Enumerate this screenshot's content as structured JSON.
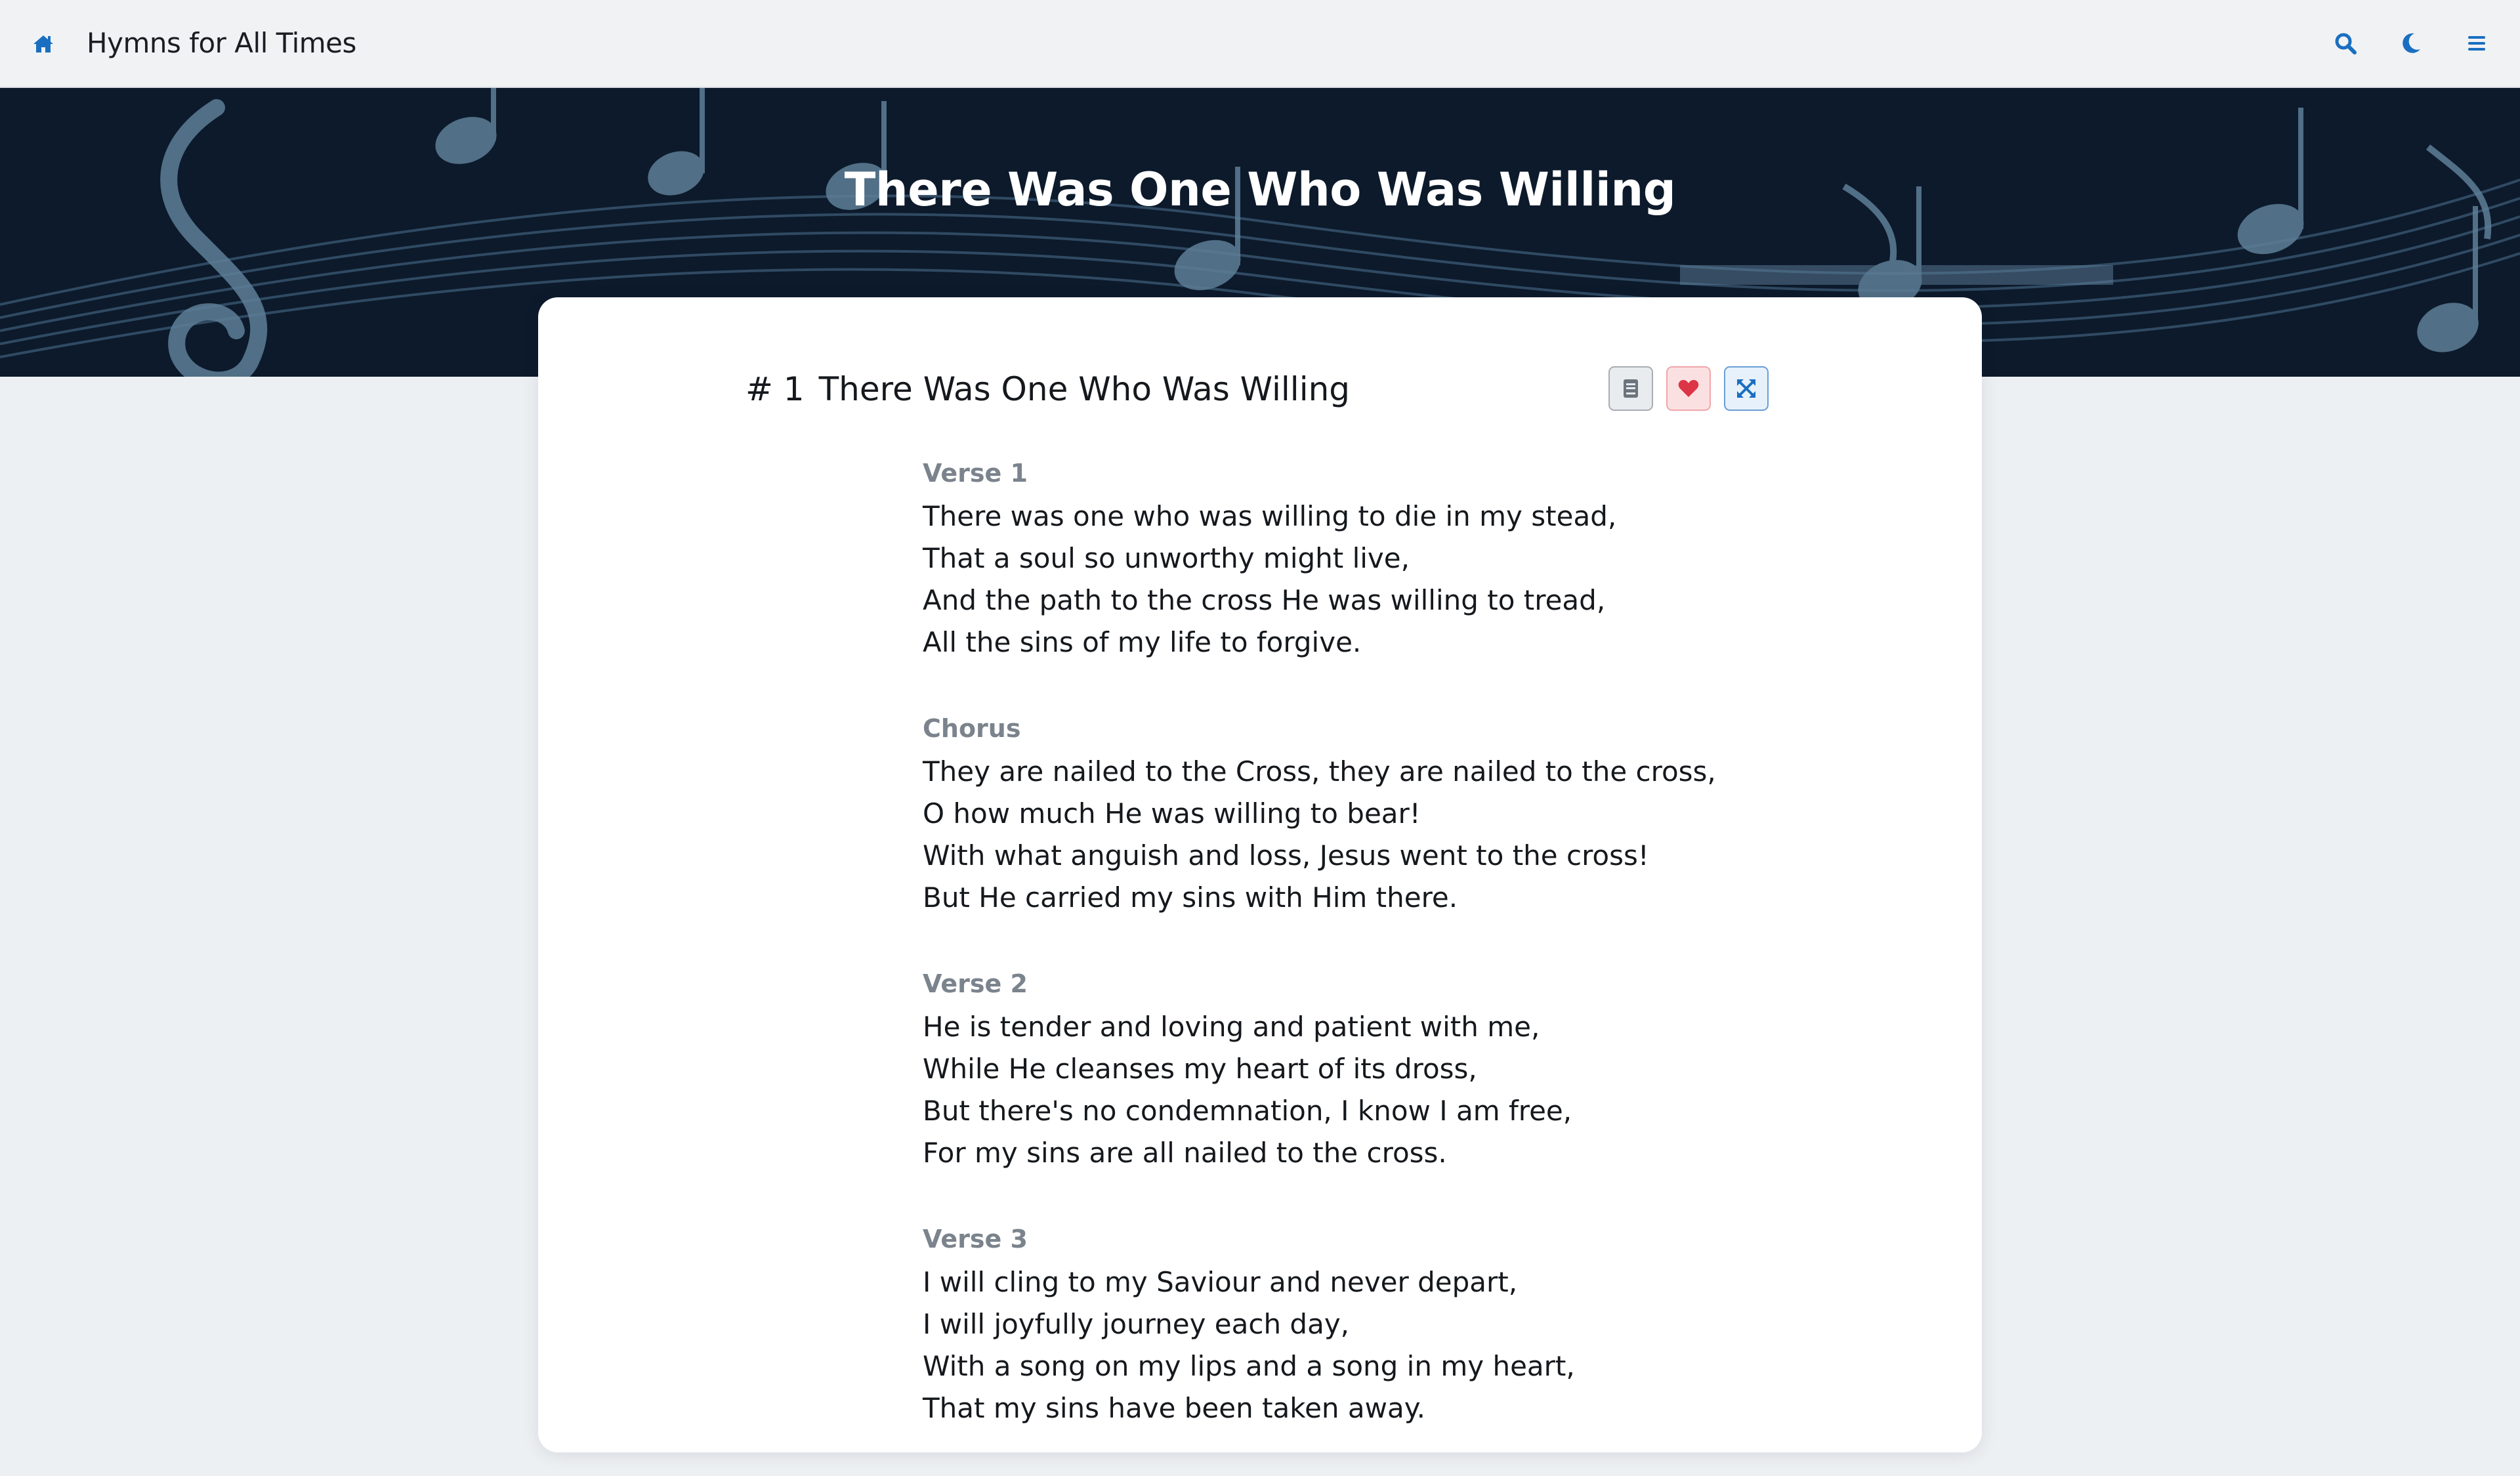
{
  "navbar": {
    "brand": "Hymns for All Times",
    "home_icon": "home-icon",
    "search_icon": "search-icon",
    "theme_icon": "moon-icon",
    "menu_icon": "menu-icon"
  },
  "hero": {
    "title": "There Was One Who Was Willing"
  },
  "hymn": {
    "number": "# 1",
    "title": "There Was One Who Was Willing",
    "actions": {
      "print_icon": "book-icon",
      "favorite_icon": "heart-icon",
      "fullscreen_icon": "expand-icon"
    },
    "stanzas": [
      {
        "label": "Verse 1",
        "lines": [
          "There was one who was willing to die in my stead,",
          "That a soul so unworthy might live,",
          "And the path to the cross He was willing to tread,",
          "All the sins of my life to forgive."
        ]
      },
      {
        "label": "Chorus",
        "lines": [
          "They are nailed to the Cross, they are nailed to the cross,",
          "O how much He was willing to bear!",
          "With what anguish and loss, Jesus went to the cross!",
          "But He carried my sins with Him there."
        ]
      },
      {
        "label": "Verse 2",
        "lines": [
          "He is tender and loving and patient with me,",
          "While He cleanses my heart of its dross,",
          "But there's no condemnation, I know I am free,",
          "For my sins are all nailed to the cross."
        ]
      },
      {
        "label": "Verse 3",
        "lines": [
          "I will cling to my Saviour and never depart,",
          "I will joyfully journey each day,",
          "With a song on my lips and a song in my heart,",
          "That my sins have been taken away."
        ]
      }
    ]
  },
  "colors": {
    "accent": "#1a6fc0",
    "favorite": "#dc3545",
    "hero_bg": "#0c1a2b",
    "label_gray": "#7b838d"
  }
}
